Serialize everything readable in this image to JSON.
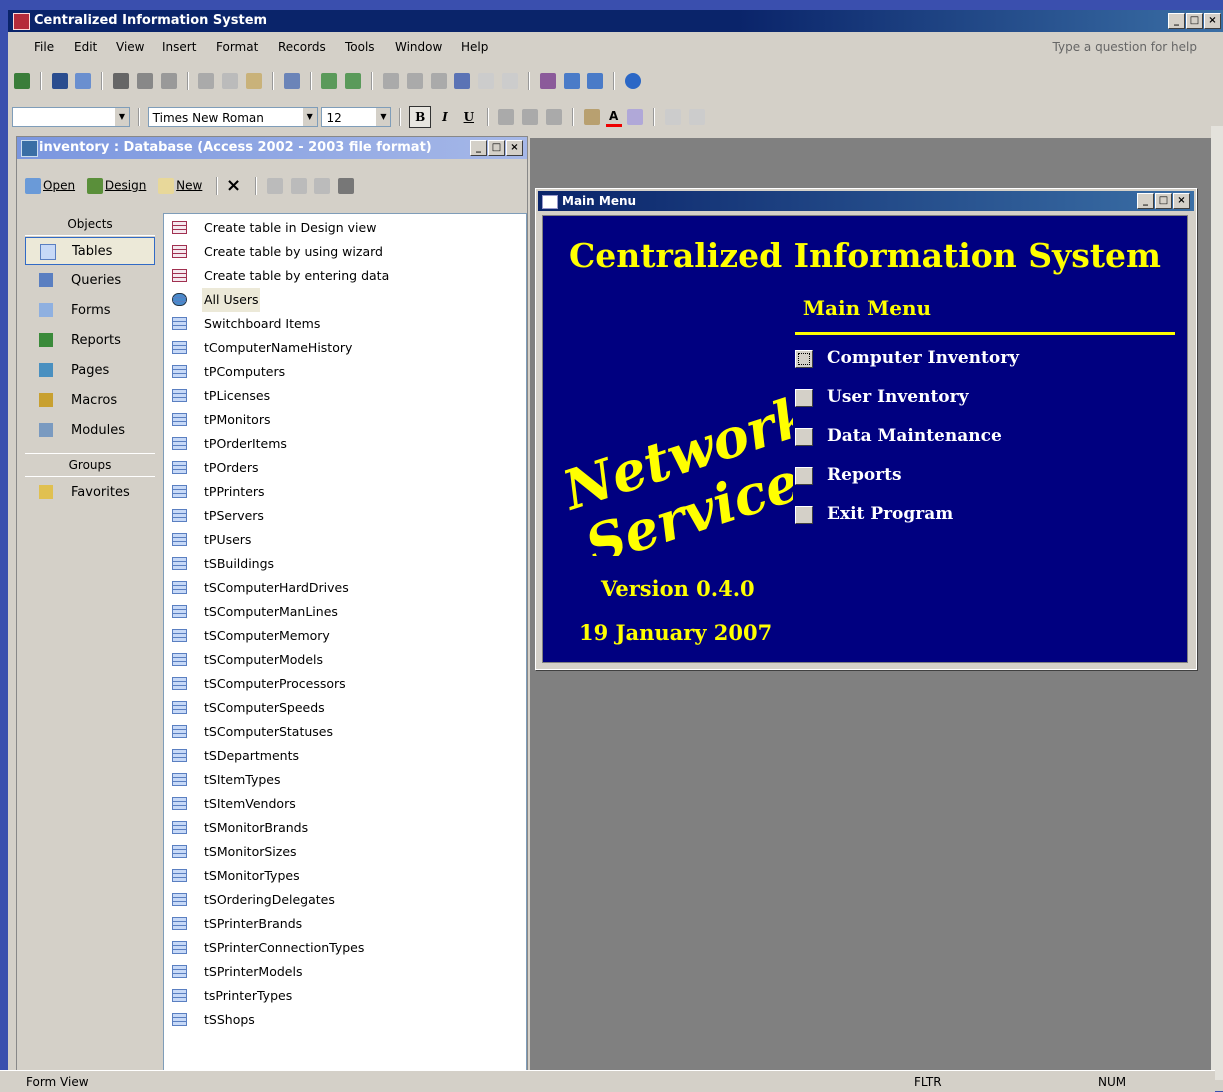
{
  "app": {
    "title": "Centralized Information System",
    "help_placeholder": "Type a question for help"
  },
  "menu": [
    "File",
    "Edit",
    "View",
    "Insert",
    "Format",
    "Records",
    "Tools",
    "Window",
    "Help"
  ],
  "format_toolbar": {
    "object_combo": "",
    "font": "Times New Roman",
    "size": "12",
    "bold": "B",
    "italic": "I",
    "underline": "U",
    "font_color": "A"
  },
  "db_window": {
    "title": "inventory : Database (Access 2002 - 2003 file format)",
    "toolbar": {
      "open": "Open",
      "design": "Design",
      "new": "New"
    },
    "objects_header": "Objects",
    "objects": [
      "Tables",
      "Queries",
      "Forms",
      "Reports",
      "Pages",
      "Macros",
      "Modules"
    ],
    "groups_header": "Groups",
    "groups": [
      "Favorites"
    ],
    "items": [
      "Create table in Design view",
      "Create table by using wizard",
      "Create table by entering data",
      "All Users",
      "Switchboard Items",
      "tComputerNameHistory",
      "tPComputers",
      "tPLicenses",
      "tPMonitors",
      "tPOrderItems",
      "tPOrders",
      "tPPrinters",
      "tPServers",
      "tPUsers",
      "tSBuildings",
      "tSComputerHardDrives",
      "tSComputerManLines",
      "tSComputerMemory",
      "tSComputerModels",
      "tSComputerProcessors",
      "tSComputerSpeeds",
      "tSComputerStatuses",
      "tSDepartments",
      "tSItemTypes",
      "tSItemVendors",
      "tSMonitorBrands",
      "tSMonitorSizes",
      "tSMonitorTypes",
      "tSOrderingDelegates",
      "tSPrinterBrands",
      "tSPrinterConnectionTypes",
      "tSPrinterModels",
      "tsPrinterTypes",
      "tSShops"
    ]
  },
  "main_menu": {
    "window_title": "Main Menu",
    "system_title": "Centralized Information System",
    "subtitle": "Main Menu",
    "logo_line1": "Network",
    "logo_line2": "Services",
    "options": [
      "Computer Inventory",
      "User Inventory",
      "Data Maintenance",
      "Reports",
      "Exit Program"
    ],
    "version": "Version 0.4.0",
    "date": "19 January 2007"
  },
  "status": {
    "mode": "Form View",
    "fltr": "FLTR",
    "num": "NUM"
  },
  "colors": {
    "form_bg": "#000080",
    "form_text": "#ffff00",
    "title_bar": "#0a246a"
  }
}
